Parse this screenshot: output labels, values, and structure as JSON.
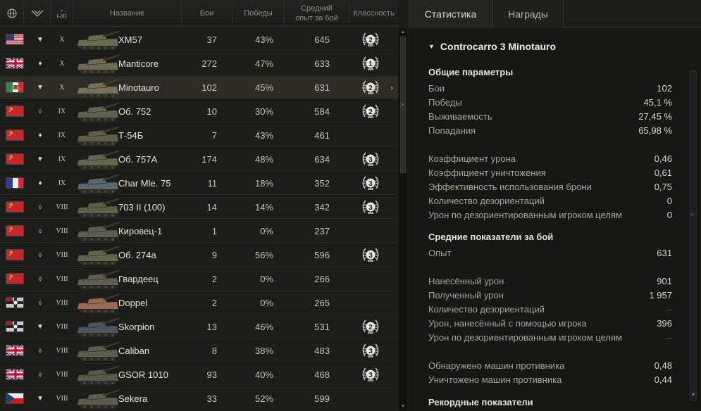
{
  "table": {
    "headers": {
      "tier_filter": "I-XI",
      "name": "Название",
      "battles": "Бои",
      "wins": "Победы",
      "avg_xp_line1": "Средний",
      "avg_xp_line2": "опыт за бой",
      "mastery": "Классность"
    },
    "header_icons": [
      "globe-icon",
      "vehicle-class-filter-icon",
      "chevron-down-icon"
    ],
    "rows": [
      {
        "nation": "usa",
        "type": "▼",
        "tier": "X",
        "name": "XM57",
        "battles": "37",
        "wins": "43%",
        "xp": "645",
        "mastery": "2",
        "selected": false
      },
      {
        "nation": "uk",
        "type": "♦",
        "tier": "X",
        "name": "Manticore",
        "battles": "272",
        "wins": "47%",
        "xp": "633",
        "mastery": "1",
        "selected": false
      },
      {
        "nation": "italy",
        "type": "▼",
        "tier": "X",
        "name": "Minotauro",
        "battles": "102",
        "wins": "45%",
        "xp": "631",
        "mastery": "2",
        "selected": true
      },
      {
        "nation": "ussr",
        "type": "⬨",
        "tier": "IX",
        "name": "Об. 752",
        "battles": "10",
        "wins": "30%",
        "xp": "584",
        "mastery": "2",
        "selected": false
      },
      {
        "nation": "ussr",
        "type": "♦",
        "tier": "IX",
        "name": "Т-54Б",
        "battles": "7",
        "wins": "43%",
        "xp": "461",
        "mastery": "",
        "selected": false
      },
      {
        "nation": "ussr",
        "type": "▼",
        "tier": "IX",
        "name": "Об. 757А",
        "battles": "174",
        "wins": "48%",
        "xp": "634",
        "mastery": "3",
        "selected": false
      },
      {
        "nation": "france",
        "type": "♦",
        "tier": "IX",
        "name": "Char Mle. 75",
        "battles": "11",
        "wins": "18%",
        "xp": "352",
        "mastery": "3",
        "selected": false
      },
      {
        "nation": "ussr",
        "type": "⬨",
        "tier": "VIII",
        "name": "703 II (100)",
        "battles": "14",
        "wins": "14%",
        "xp": "342",
        "mastery": "3",
        "selected": false
      },
      {
        "nation": "ussr",
        "type": "⬨",
        "tier": "VIII",
        "name": "Кировец-1",
        "battles": "1",
        "wins": "0%",
        "xp": "237",
        "mastery": "",
        "selected": false
      },
      {
        "nation": "ussr",
        "type": "⬨",
        "tier": "VIII",
        "name": "Об. 274а",
        "battles": "9",
        "wins": "56%",
        "xp": "596",
        "mastery": "3",
        "selected": false
      },
      {
        "nation": "ussr",
        "type": "⬨",
        "tier": "VIII",
        "name": "Гвардеец",
        "battles": "2",
        "wins": "0%",
        "xp": "266",
        "mastery": "",
        "selected": false
      },
      {
        "nation": "germany",
        "type": "⬨",
        "tier": "VIII",
        "name": "Doppel",
        "battles": "2",
        "wins": "0%",
        "xp": "265",
        "mastery": "",
        "selected": false
      },
      {
        "nation": "germany",
        "type": "▼",
        "tier": "VIII",
        "name": "Skorpion",
        "battles": "13",
        "wins": "46%",
        "xp": "531",
        "mastery": "2",
        "selected": false
      },
      {
        "nation": "uk",
        "type": "⬨",
        "tier": "VIII",
        "name": "Caliban",
        "battles": "8",
        "wins": "38%",
        "xp": "483",
        "mastery": "3",
        "selected": false
      },
      {
        "nation": "uk",
        "type": "⬨",
        "tier": "VIII",
        "name": "GSOR 1010",
        "battles": "93",
        "wins": "40%",
        "xp": "468",
        "mastery": "3",
        "selected": false
      },
      {
        "nation": "czech",
        "type": "▼",
        "tier": "VIII",
        "name": "Sekera",
        "battles": "33",
        "wins": "52%",
        "xp": "599",
        "mastery": "",
        "selected": false
      }
    ]
  },
  "tabs": {
    "stats": "Статистика",
    "awards": "Награды"
  },
  "panel": {
    "title": "Controcarro 3 Minotauro",
    "general_title": "Общие параметры",
    "general": [
      {
        "label": "Бои",
        "value": "102"
      },
      {
        "label": "Победы",
        "value": "45,1 %"
      },
      {
        "label": "Выживаемость",
        "value": "27,45 %"
      },
      {
        "label": "Попадания",
        "value": "65,98 %"
      }
    ],
    "coefficients": [
      {
        "label": "Коэффициент урона",
        "value": "0,46"
      },
      {
        "label": "Коэффициент уничтожения",
        "value": "0,61"
      },
      {
        "label": "Эффективность использования брони",
        "value": "0,75"
      },
      {
        "label": "Количество дезориентаций",
        "value": "0"
      },
      {
        "label": "Урон по дезориентированным игроком целям",
        "value": "0"
      }
    ],
    "avg_title": "Средние показатели за бой",
    "avg_xp": {
      "label": "Опыт",
      "value": "631"
    },
    "avg_damage": [
      {
        "label": "Нанесённый урон",
        "value": "901"
      },
      {
        "label": "Полученный урон",
        "value": "1 957"
      },
      {
        "label": "Количество дезориентаций",
        "value": "--"
      },
      {
        "label": "Урон, нанесённый с помощью игрока",
        "value": "396"
      },
      {
        "label": "Урон по дезориентированным игроком целям",
        "value": "--"
      }
    ],
    "avg_enemies": [
      {
        "label": "Обнаружено машин противника",
        "value": "0,48"
      },
      {
        "label": "Уничтожено машин противника",
        "value": "0,44"
      }
    ],
    "records_title": "Рекордные показатели"
  }
}
